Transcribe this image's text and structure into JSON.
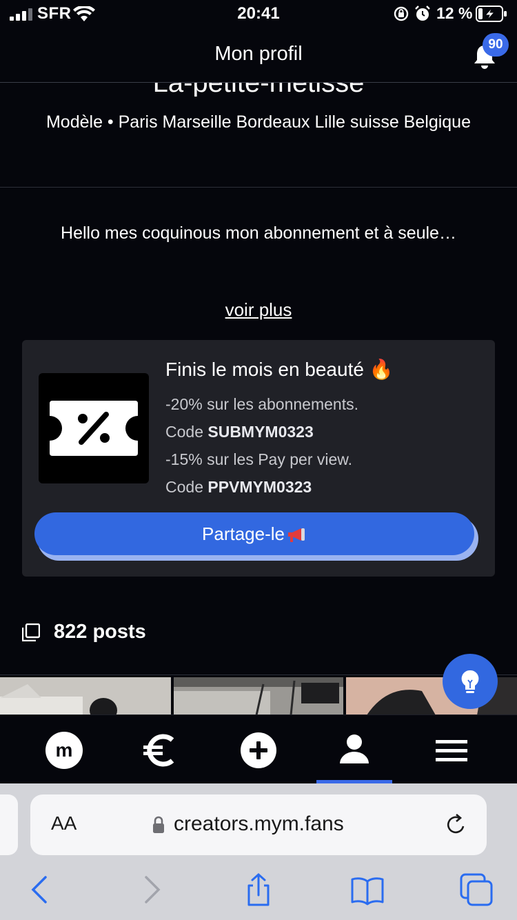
{
  "status_bar": {
    "carrier": "SFR",
    "time": "20:41",
    "battery_percent": "12 %"
  },
  "header": {
    "title": "Mon profil",
    "notifications_count": "90"
  },
  "profile": {
    "name": "La-petite-métisse",
    "profession": "Modèle • Paris Marseille Bordeaux Lille suisse Belgique",
    "bio": "Hello mes coquinous mon abonnement et à seule…",
    "see_more": "voir plus"
  },
  "promo": {
    "title": "Finis le mois en beauté 🔥",
    "line1": "-20% sur les abonnements.",
    "code_prefix": "Code ",
    "code1": "SUBMYM0323",
    "line2": "-15% sur les Pay per view.",
    "code2": "PPVMYM0323",
    "share_label": "Partage-le"
  },
  "posts": {
    "count_label": "822 posts"
  },
  "bottom_nav": {
    "items": [
      "home-logo",
      "earnings-euro",
      "create-plus",
      "profile-user",
      "menu-hamburger"
    ],
    "logo_letter": "m",
    "active": "profile-user"
  },
  "browser": {
    "aa_label": "AA",
    "url": "creators.mym.fans"
  },
  "colors": {
    "background": "#05060c",
    "card": "#202127",
    "accent": "#3268e0"
  }
}
